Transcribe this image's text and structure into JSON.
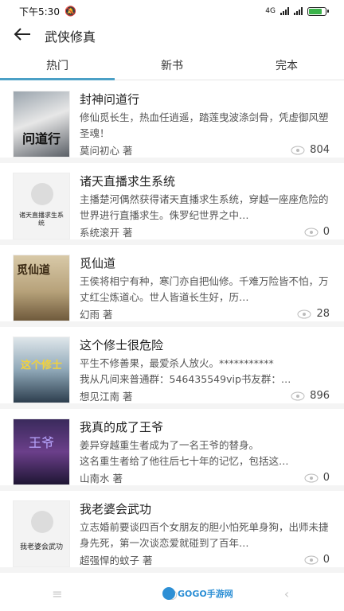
{
  "status": {
    "time": "下午5:30",
    "net": "4G"
  },
  "header": {
    "title": "武侠修真"
  },
  "tabs": [
    {
      "label": "热门",
      "active": true
    },
    {
      "label": "新书",
      "active": false
    },
    {
      "label": "完本",
      "active": false
    }
  ],
  "books": [
    {
      "title": "封神问道行",
      "desc": "修仙觅长生，热血任逍遥，踏莲曳波涤剑骨，凭虚御风塑圣魂！",
      "author": "莫问初心 著",
      "views": "804",
      "cover_text": "问道行"
    },
    {
      "title": "诸天直播求生系统",
      "desc": "主播楚河偶然获得诸天直播求生系统，穿越一座座危险的世界进行直播求生。侏罗纪世界之中…",
      "author": "系统滚开 著",
      "views": "0",
      "cover_text": "诸天直播求生系统"
    },
    {
      "title": "觅仙道",
      "desc": "王侯将相宁有种，寒门亦自把仙修。千难万险皆不怕，万丈红尘炼道心。世人皆道长生好，历…",
      "author": "幻雨 著",
      "views": "28",
      "cover_text": "觅仙道"
    },
    {
      "title": "这个修士很危险",
      "desc": "平生不修善果，最爱杀人放火。***********\n我从凡间来普通群：546435549vip书友群：…",
      "author": "想见江南 著",
      "views": "896",
      "cover_text": "这个修士"
    },
    {
      "title": "我真的成了王爷",
      "desc": "姜异穿越重生者成为了一名王爷的替身。\n这名重生者给了他往后七十年的记忆，包括这…",
      "author": "山南水 著",
      "views": "0",
      "cover_text": "王爷"
    },
    {
      "title": "我老婆会武功",
      "desc": "立志婚前要谈四百个女朋友的胆小怕死单身狗，出师未捷身先死，第一次谈恋爱就碰到了百年…",
      "author": "超强悍的蚊子 著",
      "views": "0",
      "cover_text": "我老婆会武功"
    }
  ],
  "watermark": {
    "text": "GOGO手游网"
  },
  "colors": {
    "accent": "#4ba0c6",
    "battery": "#3bb34a"
  }
}
